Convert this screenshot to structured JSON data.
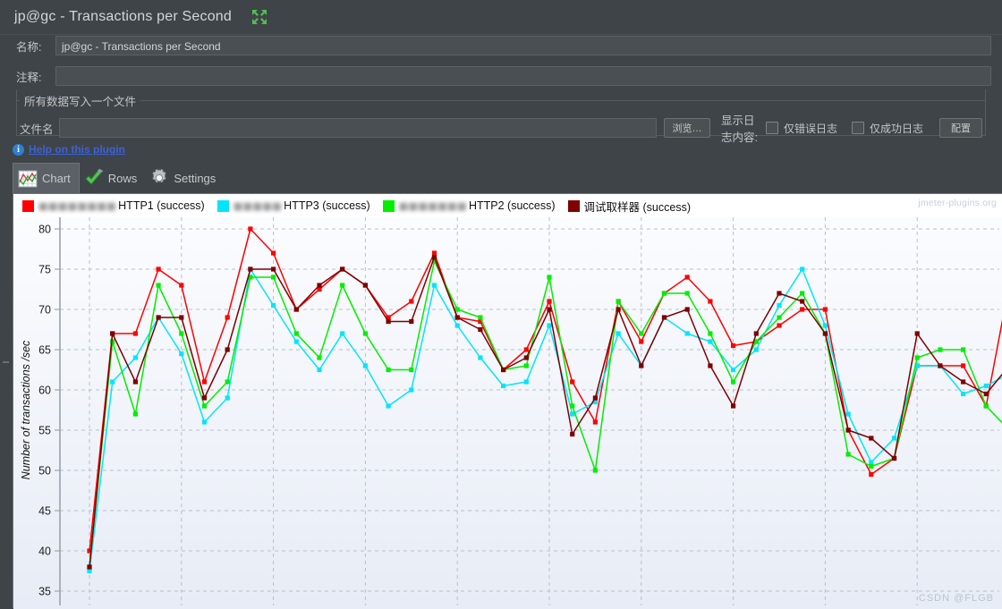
{
  "window": {
    "title": "jp@gc - Transactions per Second",
    "expand_icon": "expand-arrows-icon"
  },
  "form": {
    "name_label": "名称:",
    "name_value": "jp@gc - Transactions per Second",
    "comment_label": "注释:",
    "comment_value": "",
    "group_title": "所有数据写入一个文件",
    "filename_label": "文件名",
    "filename_value": "",
    "browse_button": "浏览…",
    "log_content_label": "显示日志内容:",
    "errors_only_label": "仅错误日志",
    "success_only_label": "仅成功日志",
    "configure_button": "配置"
  },
  "help": {
    "link_text": "Help on this plugin",
    "icon": "info-icon"
  },
  "tabs": [
    {
      "label": "Chart",
      "icon": "chart-icon",
      "active": true
    },
    {
      "label": "Rows",
      "icon": "check-icon",
      "active": false
    },
    {
      "label": "Settings",
      "icon": "gear-icon",
      "active": false
    }
  ],
  "watermarks": {
    "top_right": "jmeter-plugins.org",
    "bottom_right": "CSDN @FLGB"
  },
  "chart_data": {
    "type": "line",
    "title": "",
    "xlabel": "",
    "ylabel": "Number of transactions /sec",
    "ylim": [
      35,
      80
    ],
    "yticks": [
      35,
      40,
      45,
      50,
      55,
      60,
      65,
      70,
      75,
      80
    ],
    "grid": true,
    "legend_position": "top-left",
    "x": [
      1,
      2,
      3,
      4,
      5,
      6,
      7,
      8,
      9,
      10,
      11,
      12,
      13,
      14,
      15,
      16,
      17,
      18,
      19,
      20,
      21,
      22,
      23,
      24,
      25,
      26,
      27,
      28,
      29,
      30,
      31,
      32,
      33,
      34,
      35,
      36,
      37,
      38,
      39,
      40,
      41
    ],
    "series": [
      {
        "name": "HTTP1 (success)",
        "label_prefix_blurred": "▩▩▩▩▩▩▩▩",
        "color": "#ff0000",
        "values": [
          40,
          67,
          67,
          75,
          73,
          61,
          69,
          80,
          77,
          70,
          72.5,
          75,
          73,
          69,
          71,
          77,
          69,
          68.5,
          62.5,
          65,
          71,
          61,
          56,
          71,
          66,
          72,
          74,
          71,
          65.5,
          66,
          68,
          70,
          70,
          55,
          49.5,
          51.5,
          63,
          63,
          63,
          58,
          73
        ]
      },
      {
        "name": "HTTP3 (success)",
        "label_prefix_blurred": "▩▩▩▩▩",
        "color": "#00e5ff",
        "values": [
          37.5,
          61,
          64,
          69,
          64.5,
          56,
          59,
          75,
          70.5,
          66,
          62.5,
          67,
          63,
          58,
          60,
          73,
          68,
          64,
          60.5,
          61,
          68,
          57,
          58.5,
          67,
          63,
          69,
          67,
          66,
          62.5,
          65,
          70.5,
          75,
          68,
          57,
          51,
          54,
          63,
          63,
          59.5,
          60.5,
          62
        ]
      },
      {
        "name": "HTTP2 (success)",
        "label_prefix_blurred": "▩▩▩▩▩▩▩",
        "color": "#00ee00",
        "values": [
          38,
          66,
          57,
          73,
          67,
          58,
          61,
          74,
          74,
          67,
          64,
          73,
          67,
          62.5,
          62.5,
          76,
          70,
          69,
          62.5,
          63,
          74,
          58,
          50,
          71,
          67,
          72,
          72,
          67,
          61,
          66,
          69,
          72,
          67,
          52,
          50.5,
          51.5,
          64,
          65,
          65,
          58,
          55
        ]
      },
      {
        "name": "调试取样器 (success)",
        "label_prefix_blurred": "",
        "color": "#7f0000",
        "values": [
          38,
          67,
          61,
          69,
          69,
          59,
          65,
          75,
          75,
          70,
          73,
          75,
          73,
          68.5,
          68.5,
          76.5,
          69,
          67.5,
          62.5,
          64,
          70,
          54.5,
          59,
          70,
          63,
          69,
          70,
          63,
          58,
          67,
          72,
          71,
          67,
          55,
          54,
          51.5,
          67,
          63,
          61,
          59.5,
          63
        ]
      }
    ]
  }
}
